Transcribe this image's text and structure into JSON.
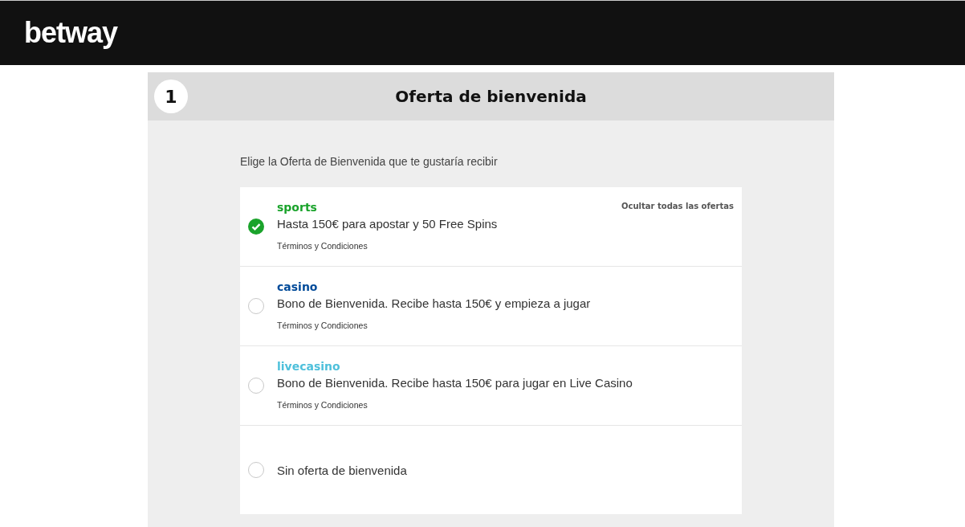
{
  "header": {
    "logo": "betway"
  },
  "step": {
    "number": "1",
    "title": "Oferta de bienvenida"
  },
  "intro": "Elige la Oferta de Bienvenida que te gustaría recibir",
  "hide_link": "Ocultar todas las ofertas",
  "offers": [
    {
      "kind": "offer",
      "name": "sports",
      "color": "#1aa32b",
      "description": "Hasta 150€ para apostar y 50 Free Spins",
      "terms": "Términos y Condiciones",
      "selected": true
    },
    {
      "kind": "offer",
      "name": "casino",
      "color": "#004a99",
      "description": "Bono de Bienvenida. Recibe hasta 150€ y empieza a jugar",
      "terms": "Términos y Condiciones",
      "selected": false
    },
    {
      "kind": "offer",
      "name": "livecasino",
      "color": "#4ec0db",
      "description": "Bono de Bienvenida. Recibe hasta 150€ para jugar en Live Casino",
      "terms": "Términos y Condiciones",
      "selected": false
    },
    {
      "kind": "none",
      "description": "Sin oferta de bienvenida",
      "selected": false
    }
  ]
}
